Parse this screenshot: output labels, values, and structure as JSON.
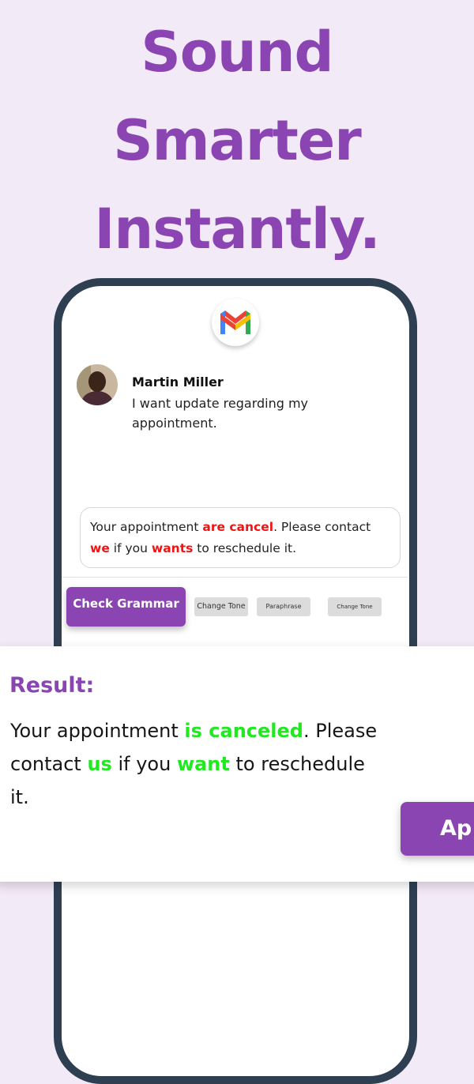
{
  "headline": {
    "line1": "Sound",
    "line2": "Smarter",
    "line3": "Instantly."
  },
  "colors": {
    "accent": "#8b45b3",
    "background": "#f3eaf7",
    "error": "#f21212",
    "success": "#21e821",
    "phone_frame": "#2f3f52"
  },
  "app": {
    "icon": "gmail-icon"
  },
  "email": {
    "sender_name": "Martin Miller",
    "message": "I want update regarding my appointment."
  },
  "draft": {
    "part1": "Your appointment ",
    "err1": "are cancel",
    "part2": ". Please contact ",
    "err2": "we",
    "part3": " if you ",
    "err3": "wants",
    "part4": " to reschedule it."
  },
  "actions": {
    "check_grammar": "Check Grammar",
    "change_tone_1": "Change Tone",
    "paraphrase": "Paraphrase",
    "change_tone_2": "Change Tone"
  },
  "result": {
    "title": "Result:",
    "part1": "Your appointment ",
    "fix1": "is canceled",
    "part2": ". Please contact ",
    "fix2": "us",
    "part3": " if you ",
    "fix3": "want",
    "part4": " to reschedule it.",
    "apply_label": "Ap"
  }
}
